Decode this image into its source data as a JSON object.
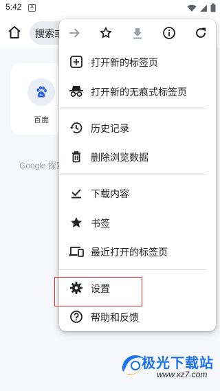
{
  "status_bar": {
    "time": "5:42",
    "notification_letter": "A"
  },
  "toolbar": {
    "omnibox_text": "搜索或输入网址"
  },
  "content": {
    "shortcut_label": "百度",
    "discover_text": "Google 探索"
  },
  "menu": {
    "top_actions": [
      {
        "icon": "forward-icon",
        "enabled": false
      },
      {
        "icon": "star-outline-icon",
        "enabled": true
      },
      {
        "icon": "download-icon",
        "enabled": false
      },
      {
        "icon": "info-icon",
        "enabled": true
      },
      {
        "icon": "refresh-icon",
        "enabled": true
      }
    ],
    "items": [
      {
        "label": "打开新的标签页",
        "icon": "new-tab-icon"
      },
      {
        "label": "打开新的无痕式标签页",
        "icon": "incognito-icon"
      },
      {
        "label": "历史记录",
        "icon": "history-icon"
      },
      {
        "label": "删除浏览数据",
        "icon": "trash-icon"
      },
      {
        "label": "下载内容",
        "icon": "download-check-icon"
      },
      {
        "label": "书签",
        "icon": "star-filled-icon"
      },
      {
        "label": "最近打开的标签页",
        "icon": "devices-icon"
      },
      {
        "label": "设置",
        "icon": "gear-icon"
      },
      {
        "label": "帮助和反馈",
        "icon": "help-icon"
      }
    ]
  },
  "watermark": {
    "text": "极光下载站",
    "url": "www.xz7.com"
  },
  "colors": {
    "highlight": "#e0302a",
    "watermark_blue": "#1a73e8"
  }
}
